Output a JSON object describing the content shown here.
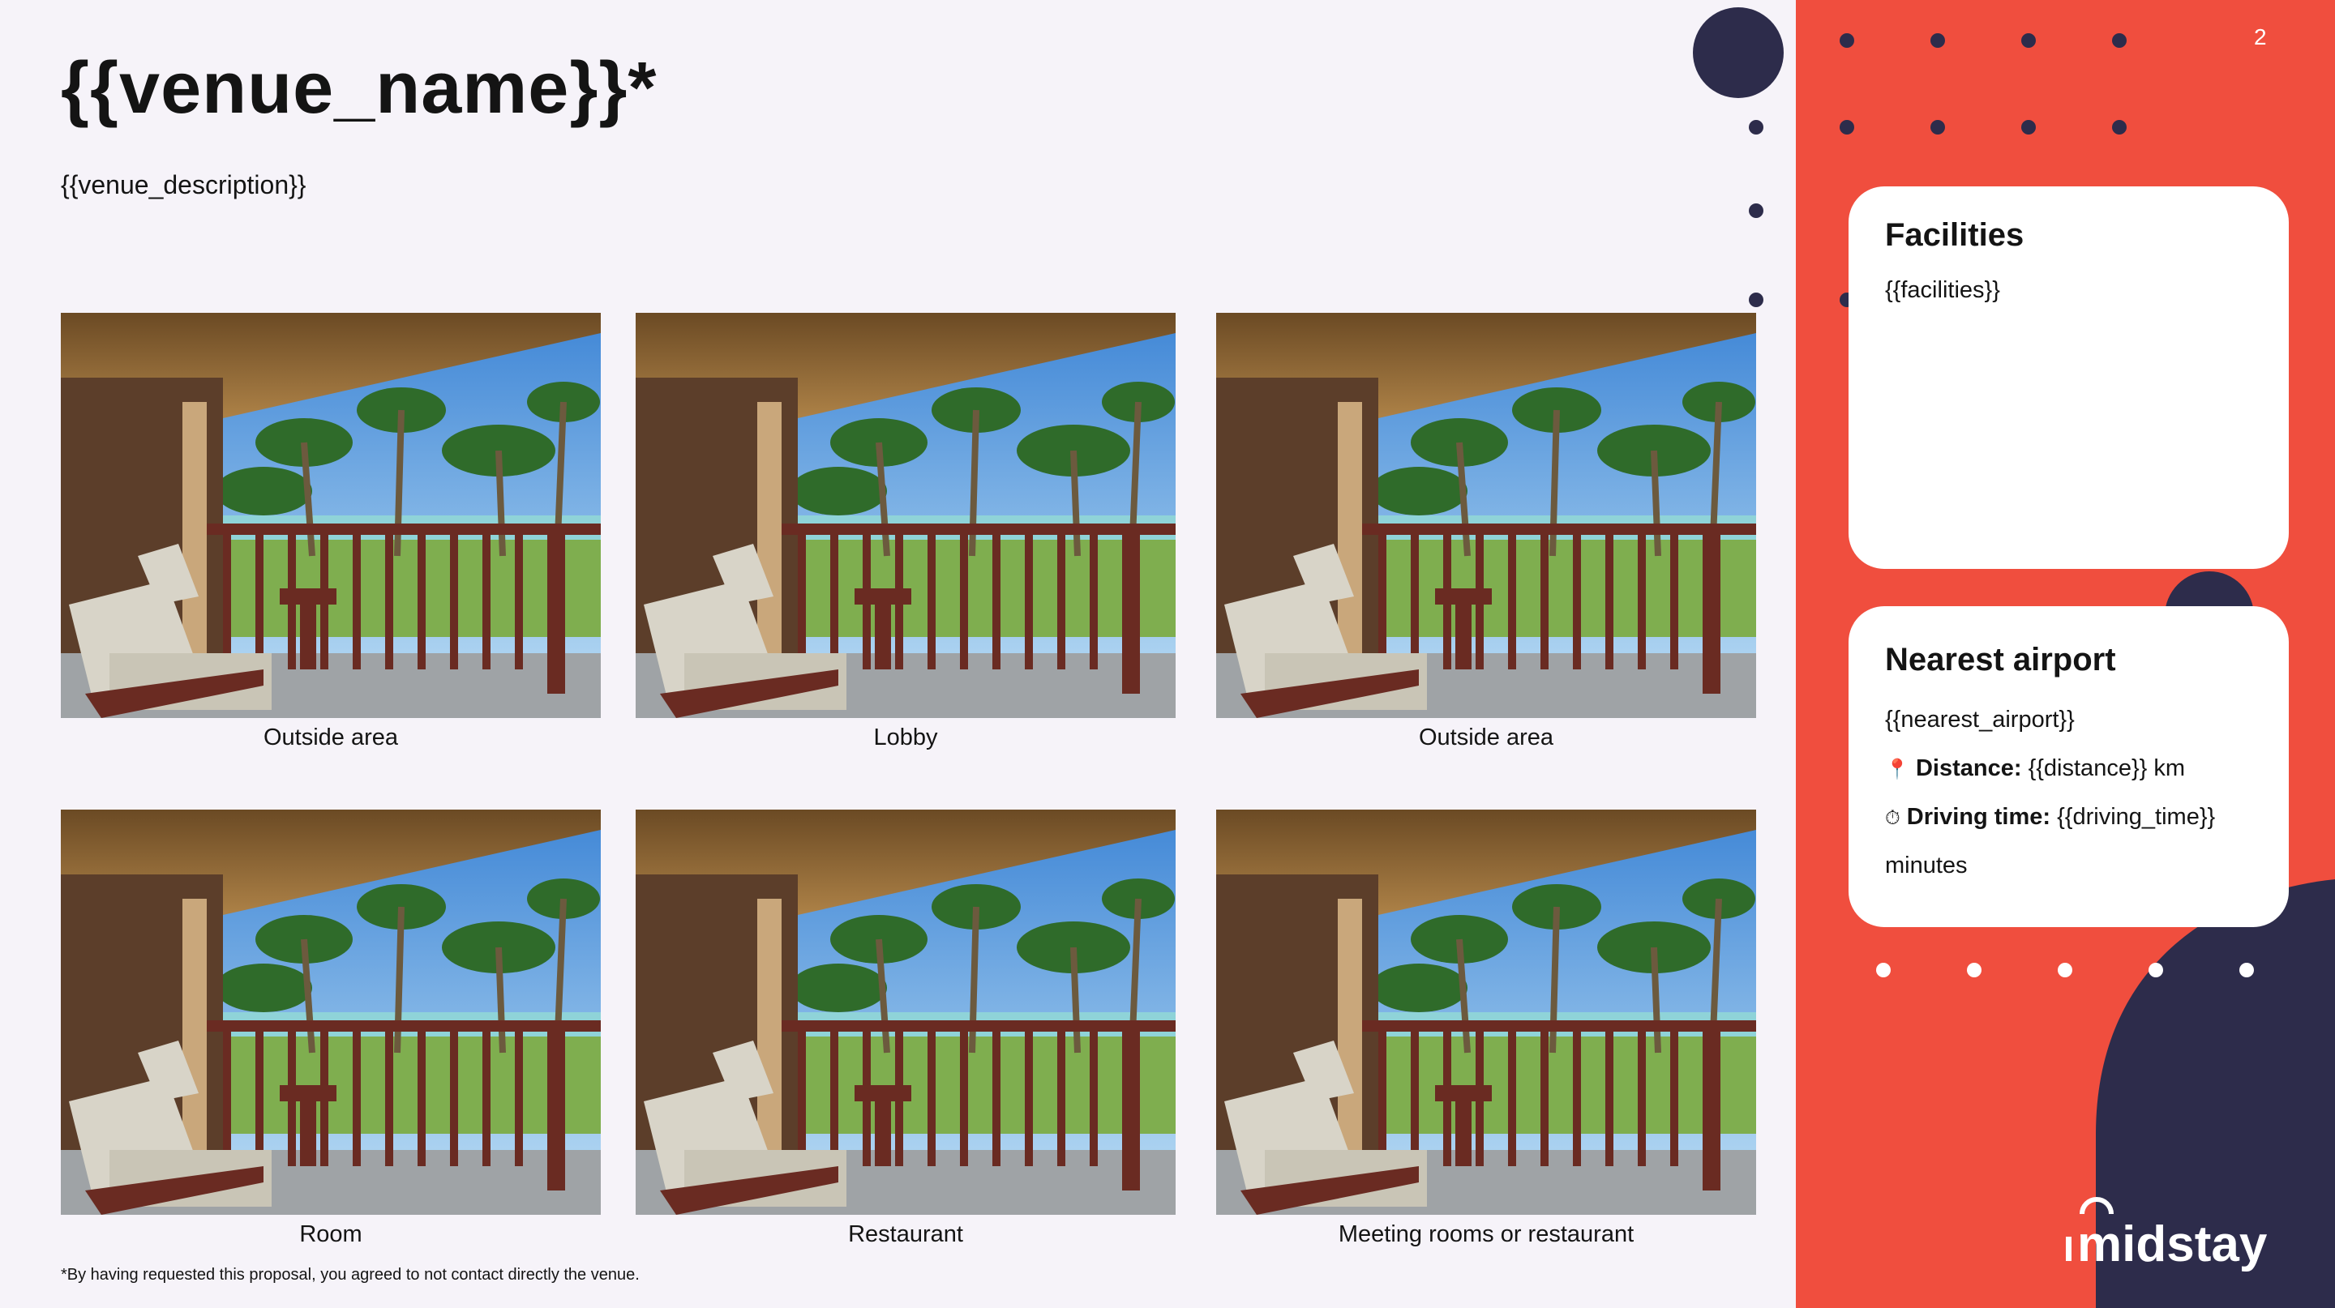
{
  "header": {
    "title": "{{venue_name}}*",
    "description": "{{venue_description}}"
  },
  "gallery": {
    "items": [
      {
        "caption": "Outside area"
      },
      {
        "caption": "Lobby"
      },
      {
        "caption": "Outside area"
      },
      {
        "caption": "Room"
      },
      {
        "caption": "Restaurant"
      },
      {
        "caption": "Meeting rooms or restaurant"
      }
    ]
  },
  "footnote": "*By having requested this proposal, you agreed to not contact directly the venue.",
  "sidebar": {
    "page_number": "2",
    "facilities": {
      "title": "Facilities",
      "value": "{{facilities}}"
    },
    "airport": {
      "title": "Nearest airport",
      "value": "{{nearest_airport}}",
      "distance_label": "Distance:",
      "distance_value": "{{distance}} km",
      "driving_label": "Driving time:",
      "driving_value": "{{driving_time}}",
      "driving_unit": "minutes",
      "pin_icon": "📍",
      "timer_icon": "⏱"
    },
    "logo_text": "midstay"
  },
  "colors": {
    "accent": "#f04e3e",
    "navy": "#2d2c4b",
    "background": "#f6f3f9"
  }
}
